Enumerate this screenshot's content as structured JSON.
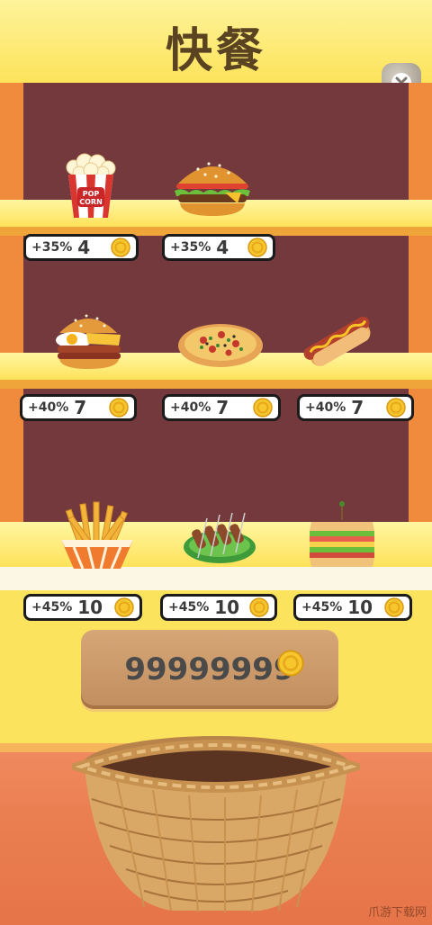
{
  "title": "快餐",
  "items": [
    {
      "name": "popcorn",
      "bonus": "+35%",
      "cost": "4"
    },
    {
      "name": "burger",
      "bonus": "+35%",
      "cost": "4"
    },
    {
      "name": "breakfast-burger",
      "bonus": "+40%",
      "cost": "7"
    },
    {
      "name": "pizza",
      "bonus": "+40%",
      "cost": "7"
    },
    {
      "name": "hotdog",
      "bonus": "+40%",
      "cost": "7"
    },
    {
      "name": "fries",
      "bonus": "+45%",
      "cost": "10"
    },
    {
      "name": "kebabs",
      "bonus": "+45%",
      "cost": "10"
    },
    {
      "name": "sandwich",
      "bonus": "+45%",
      "cost": "10"
    }
  ],
  "popcorn_text": "POP CORN",
  "balance": "99999999",
  "watermark": "爪游下载网",
  "colors": {
    "cabinet": "#74393d",
    "shelf": "#fde25a",
    "side": "#f08a3c",
    "coin": "#f7c52c",
    "floor": "#ea7f51"
  },
  "icons": {
    "close": "close-icon",
    "coin": "coin-icon"
  }
}
